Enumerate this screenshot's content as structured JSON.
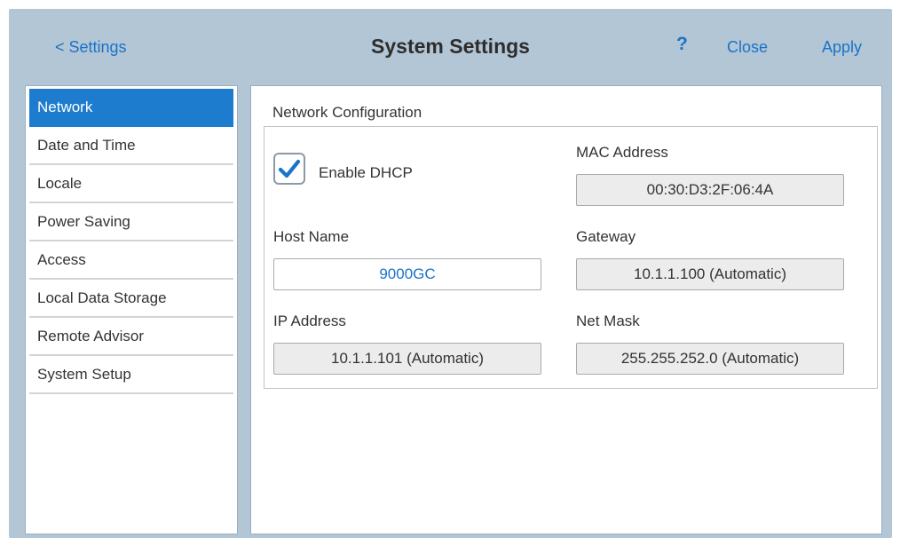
{
  "header": {
    "back_label": "< Settings",
    "title": "System Settings",
    "help_label": "?",
    "close_label": "Close",
    "apply_label": "Apply"
  },
  "sidebar": {
    "items": [
      {
        "label": "Network",
        "active": true
      },
      {
        "label": "Date and Time",
        "active": false
      },
      {
        "label": "Locale",
        "active": false
      },
      {
        "label": "Power Saving",
        "active": false
      },
      {
        "label": "Access",
        "active": false
      },
      {
        "label": "Local Data Storage",
        "active": false
      },
      {
        "label": "Remote Advisor",
        "active": false
      },
      {
        "label": "System Setup",
        "active": false
      }
    ]
  },
  "network": {
    "section_title": "Network Configuration",
    "dhcp": {
      "label": "Enable DHCP",
      "checked": true
    },
    "host_name": {
      "label": "Host Name",
      "value": "9000GC"
    },
    "ip_address": {
      "label": "IP Address",
      "value": "10.1.1.101 (Automatic)"
    },
    "mac_address": {
      "label": "MAC Address",
      "value": "00:30:D3:2F:06:4A"
    },
    "gateway": {
      "label": "Gateway",
      "value": "10.1.1.100 (Automatic)"
    },
    "net_mask": {
      "label": "Net Mask",
      "value": "255.255.252.0 (Automatic)"
    }
  },
  "colors": {
    "accent": "#1a73c8",
    "active_item_bg": "#1d7ccd",
    "frame_bg": "#b3c6d5",
    "readonly_field_bg": "#ececec"
  },
  "icons": {
    "checkbox_check": "check-icon"
  }
}
